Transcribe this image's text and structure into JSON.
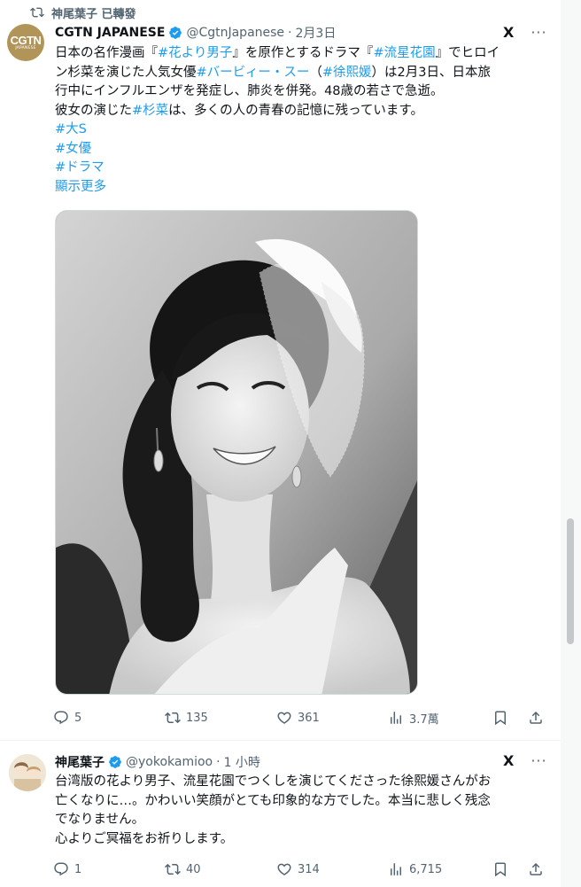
{
  "retweet_context": {
    "label": "神尾葉子 已轉發"
  },
  "tweet1": {
    "author": {
      "avatar_line1": "CGTN",
      "avatar_line2": "JAPANESE",
      "name": "CGTN JAPANESE",
      "handle": "@CgtnJapanese",
      "separator": "·",
      "time": "2月3日"
    },
    "grok_label": "X",
    "more_label": "···",
    "text_lines": [
      [
        {
          "t": "日本の名作漫画『",
          "tag": false
        },
        {
          "t": "#花より男子",
          "tag": true
        },
        {
          "t": "』を原作とするドラマ『",
          "tag": false
        },
        {
          "t": "#流星花園",
          "tag": true
        },
        {
          "t": "』でヒロイ",
          "tag": false
        }
      ],
      [
        {
          "t": "ン杉菜を演じた人気女優",
          "tag": false
        },
        {
          "t": "#バービィー・スー",
          "tag": true
        },
        {
          "t": "（",
          "tag": false
        },
        {
          "t": "#徐熙媛",
          "tag": true
        },
        {
          "t": "）は2月3日、日本旅",
          "tag": false
        }
      ],
      [
        {
          "t": "行中にインフルエンザを発症し、肺炎を併発。48歳の若さで急逝。",
          "tag": false
        }
      ],
      [
        {
          "t": "彼女の演じた",
          "tag": false
        },
        {
          "t": "#杉菜",
          "tag": true
        },
        {
          "t": "は、多くの人の青春の記憶に残っています。",
          "tag": false
        }
      ],
      [
        {
          "t": "#大S",
          "tag": true
        }
      ],
      [
        {
          "t": "#女優",
          "tag": true
        }
      ],
      [
        {
          "t": "#ドラマ",
          "tag": true
        }
      ],
      [
        {
          "t": "顯示更多",
          "tag": true
        }
      ]
    ],
    "actions": {
      "replies": "5",
      "reposts": "135",
      "likes": "361",
      "views": "3.7萬"
    }
  },
  "tweet2": {
    "author": {
      "name": "神尾葉子",
      "handle": "@yokokamioo",
      "separator": "·",
      "time": "1 小時"
    },
    "grok_label": "X",
    "more_label": "···",
    "text_lines": [
      "台湾版の花より男子、流星花園でつくしを演じてくださった徐熙媛さんがお",
      "亡くなりに…。かわいい笑顔がとても印象的な方でした。本当に悲しく残念",
      "でなりません。",
      "心よりご冥福をお祈りします。"
    ],
    "actions": {
      "replies": "1",
      "reposts": "40",
      "likes": "314",
      "views": "6,715"
    }
  },
  "colors": {
    "accent": "#1d9bf0",
    "secondary_text": "#536471",
    "primary_text": "#0f1419",
    "cgtn_gold": "#b19558"
  }
}
